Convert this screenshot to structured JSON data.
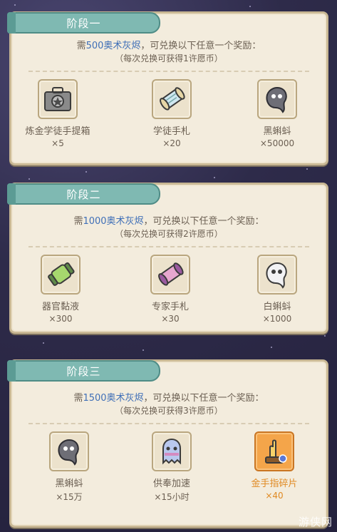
{
  "stages": [
    {
      "title": "阶段一",
      "req_prefix": "需",
      "req_amount": "500奥术灰烬",
      "req_suffix": "，可兑换以下任意一个奖励：",
      "note": "（每次兑换可获得1许愿币）",
      "items": [
        {
          "name": "炼金学徒手提箱",
          "qty": "×5",
          "icon": "toolbox-icon"
        },
        {
          "name": "学徒手札",
          "qty": "×20",
          "icon": "scroll-icon"
        },
        {
          "name": "黑蝌蚪",
          "qty": "×50000",
          "icon": "black-tadpole-icon"
        }
      ]
    },
    {
      "title": "阶段二",
      "req_prefix": "需",
      "req_amount": "1000奥术灰烬",
      "req_suffix": "，可兑换以下任意一个奖励：",
      "note": "（每次兑换可获得2许愿币）",
      "items": [
        {
          "name": "器官黏液",
          "qty": "×300",
          "icon": "slime-vial-icon"
        },
        {
          "name": "专家手札",
          "qty": "×30",
          "icon": "expert-scroll-icon"
        },
        {
          "name": "白蝌蚪",
          "qty": "×1000",
          "icon": "white-tadpole-icon"
        }
      ]
    },
    {
      "title": "阶段三",
      "req_prefix": "需",
      "req_amount": "1500奥术灰烬",
      "req_suffix": "，可兑换以下任意一个奖励：",
      "note": "（每次兑换可获得3许愿币）",
      "items": [
        {
          "name": "黑蝌蚪",
          "qty": "×15万",
          "icon": "black-tadpole-icon"
        },
        {
          "name": "供奉加速",
          "qty": "×15小时",
          "icon": "ghost-speedup-icon"
        },
        {
          "name": "金手指碎片",
          "qty": "×40",
          "icon": "golden-finger-fragment-icon"
        }
      ]
    }
  ],
  "watermark": "游侠网",
  "colors": {
    "accent_blue": "#3f6fb7",
    "ribbon": "#7fb9b2",
    "gold": "#e08a23"
  }
}
